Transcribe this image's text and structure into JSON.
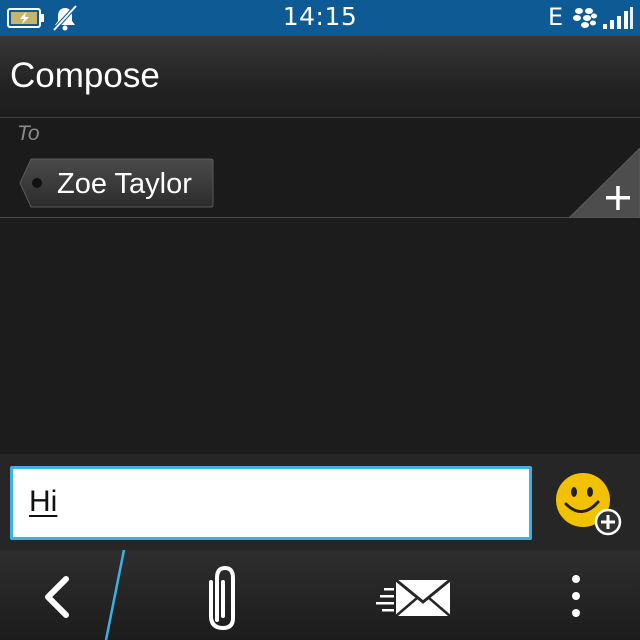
{
  "status_bar": {
    "time": "14:15",
    "network": "E",
    "icons": [
      "battery-charging-icon",
      "notifications-muted-icon",
      "blackberry-messenger-icon",
      "signal-strength-icon"
    ]
  },
  "header": {
    "title": "Compose"
  },
  "recipients": {
    "to_label": "To",
    "items": [
      {
        "name": "Zoe Taylor"
      }
    ],
    "add_icon": "plus-icon"
  },
  "message": {
    "value": "Hi"
  },
  "toolbar": {
    "icons": [
      "back-chevron-icon",
      "paperclip-icon",
      "send-mail-icon",
      "overflow-menu-icon",
      "emoticon-add-icon"
    ]
  },
  "colors": {
    "status_bar": "#0e5a94",
    "accent": "#3ab2e6",
    "background": "#1c1c1c",
    "emoji_yellow": "#f2c200"
  }
}
